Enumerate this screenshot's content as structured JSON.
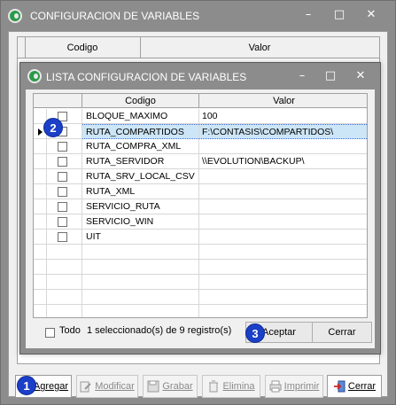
{
  "outer_window": {
    "title": "CONFIGURACION DE VARIABLES",
    "controls": [
      "–",
      "□",
      "✕"
    ]
  },
  "background_grid": {
    "columns": [
      "Codigo",
      "Valor"
    ]
  },
  "toolbar": {
    "buttons": [
      {
        "label": "Agregar",
        "icon": "add-icon",
        "enabled": true
      },
      {
        "label": "Modificar",
        "icon": "edit-icon",
        "enabled": false
      },
      {
        "label": "Grabar",
        "icon": "save-icon",
        "enabled": false
      },
      {
        "label": "Elimina",
        "icon": "delete-icon",
        "enabled": false
      },
      {
        "label": "Imprimir",
        "icon": "print-icon",
        "enabled": false
      },
      {
        "label": "Cerrar",
        "icon": "exit-icon",
        "enabled": true
      }
    ]
  },
  "dialog": {
    "title": "LISTA CONFIGURACION DE VARIABLES",
    "controls": [
      "–",
      "□",
      "✕"
    ],
    "grid": {
      "columns": [
        "Codigo",
        "Valor"
      ],
      "rows": [
        {
          "code": "BLOQUE_MAXIMO",
          "value": "100",
          "checked": false,
          "selected": false
        },
        {
          "code": "RUTA_COMPARTIDOS",
          "value": "F:\\CONTASIS\\COMPARTIDOS\\",
          "checked": false,
          "selected": true
        },
        {
          "code": "RUTA_COMPRA_XML",
          "value": "",
          "checked": false,
          "selected": false
        },
        {
          "code": "RUTA_SERVIDOR",
          "value": "\\\\EVOLUTION\\BACKUP\\",
          "checked": false,
          "selected": false
        },
        {
          "code": "RUTA_SRV_LOCAL_CSV",
          "value": "",
          "checked": false,
          "selected": false
        },
        {
          "code": "RUTA_XML",
          "value": "",
          "checked": false,
          "selected": false
        },
        {
          "code": "SERVICIO_RUTA",
          "value": "",
          "checked": false,
          "selected": false
        },
        {
          "code": "SERVICIO_WIN",
          "value": "",
          "checked": false,
          "selected": false
        },
        {
          "code": "UIT",
          "value": "",
          "checked": false,
          "selected": false
        }
      ]
    },
    "footer": {
      "todo_label": "Todo",
      "status": "1 seleccionado(s) de 9 registro(s)",
      "accept_label": "Aceptar",
      "close_label": "Cerrar"
    }
  },
  "callouts": [
    "1",
    "2",
    "3"
  ],
  "colors": {
    "titlebar": "#8c8c8c",
    "selection": "#cde6f7",
    "badge": "#1b3fc7"
  }
}
